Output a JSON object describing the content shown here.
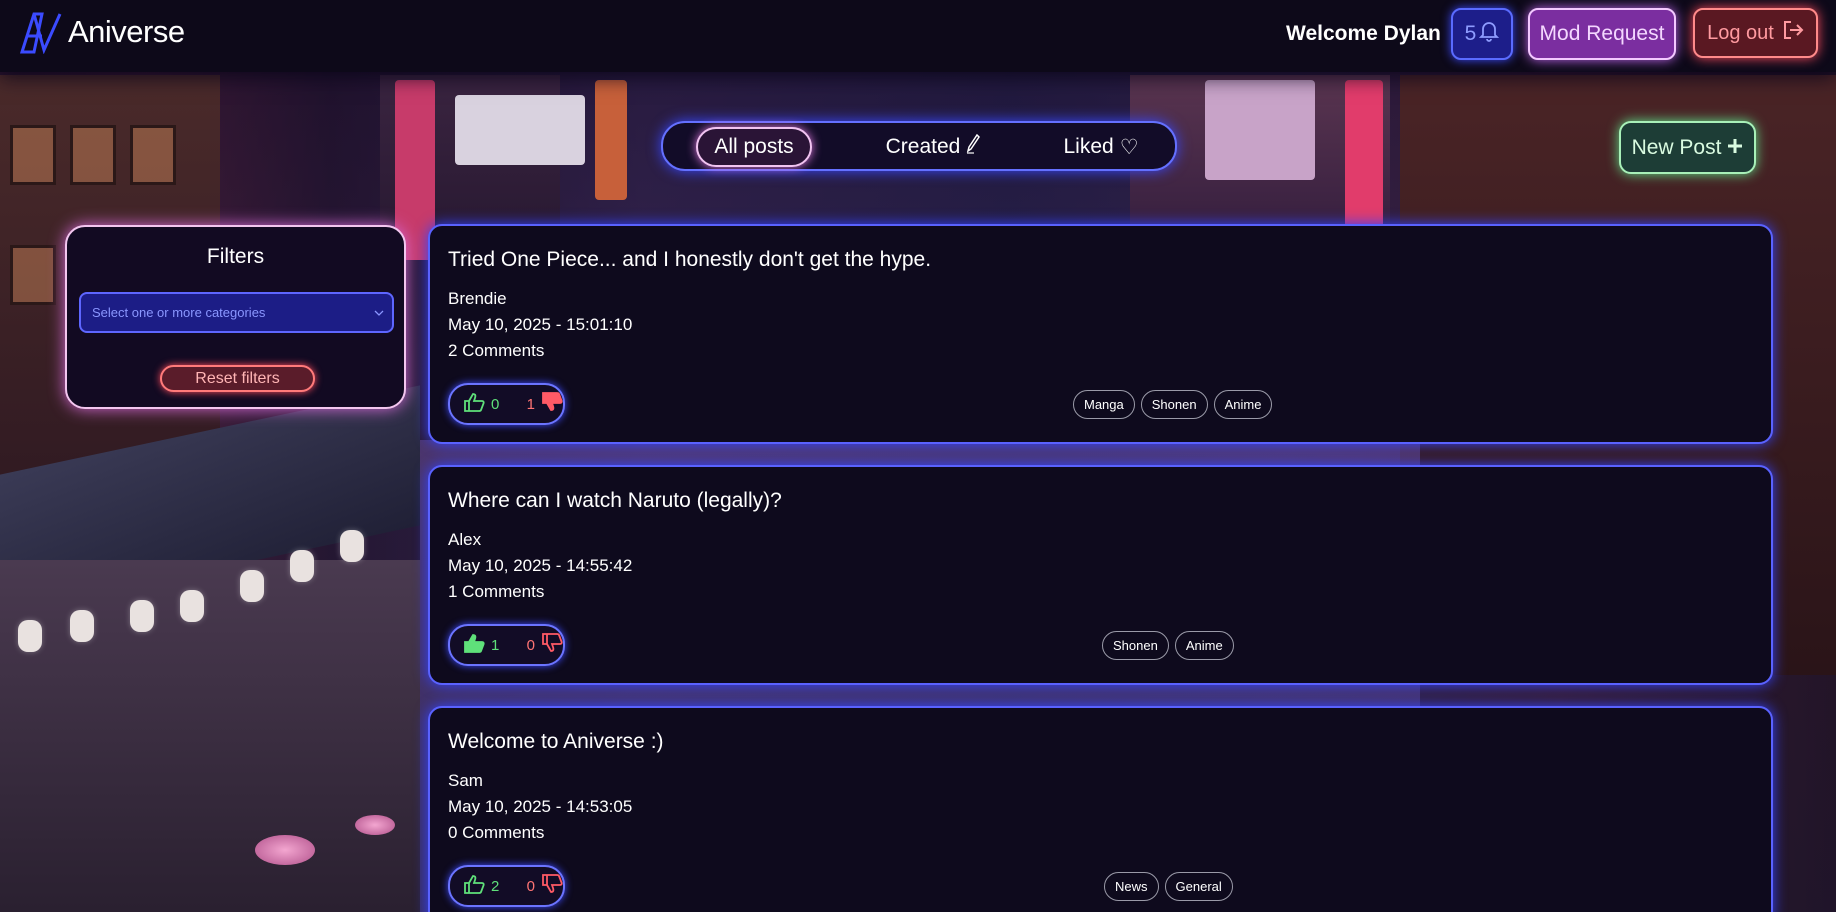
{
  "header": {
    "app_name": "Aniverse",
    "welcome": "Welcome Dylan",
    "notification_count": "5",
    "mod_request_label": "Mod Request",
    "logout_label": "Log out"
  },
  "tabs": {
    "all_posts": "All posts",
    "created": "Created",
    "liked": "Liked",
    "liked_glyph": "♡",
    "active": "all_posts"
  },
  "new_post_label": "New Post",
  "filters": {
    "title": "Filters",
    "category_placeholder": "Select one or more categories",
    "reset_label": "Reset filters"
  },
  "posts": [
    {
      "title": "Tried One Piece... and I honestly don't get the hype.",
      "author": "Brendie",
      "date": "May 10, 2025 - 15:01:10",
      "comments": "2 Comments",
      "likes": "0",
      "dislikes": "1",
      "tags": [
        "Manga",
        "Shonen",
        "Anime"
      ]
    },
    {
      "title": "Where can I watch Naruto (legally)?",
      "author": "Alex",
      "date": "May 10, 2025 - 14:55:42",
      "comments": "1 Comments",
      "likes": "1",
      "dislikes": "0",
      "tags": [
        "Shonen",
        "Anime"
      ]
    },
    {
      "title": "Welcome to Aniverse :)",
      "author": "Sam",
      "date": "May 10, 2025 - 14:53:05",
      "comments": "0 Comments",
      "likes": "2",
      "dislikes": "0",
      "tags": [
        "News",
        "General"
      ]
    }
  ],
  "icons": {
    "notification": "bell-icon",
    "logout": "logout-icon",
    "created": "pen-icon",
    "new_post": "plus-icon",
    "like": "thumbs-up-icon",
    "dislike": "thumbs-down-icon",
    "select": "chevron-down-icon"
  },
  "colors": {
    "neon_blue": "#5a62ff",
    "neon_pink": "#f3c6ef",
    "neon_green": "#a8f0b8",
    "neon_red": "#ff7a7a",
    "like_green": "#5fe07a",
    "dislike_red": "#ff7474"
  }
}
